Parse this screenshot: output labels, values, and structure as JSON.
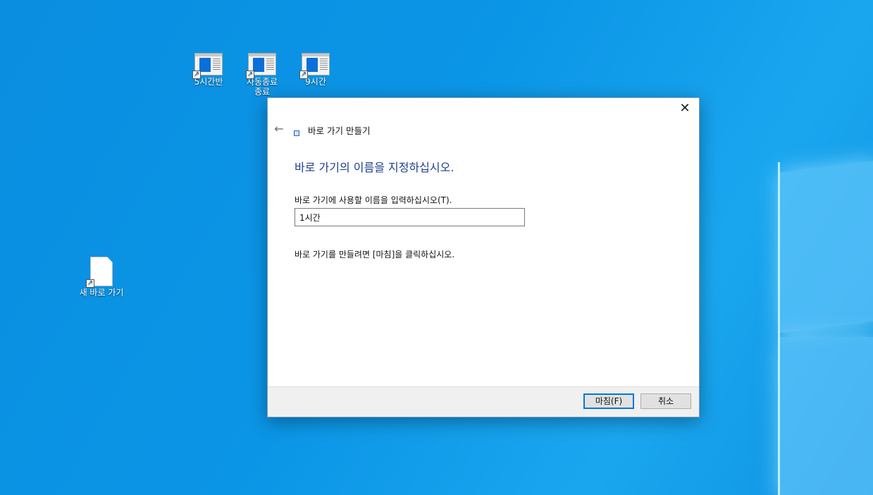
{
  "desktop": {
    "icons": [
      {
        "label": "5시간반"
      },
      {
        "label": "자동종료\n종료"
      },
      {
        "label": "9시간"
      },
      {
        "label": "새 바로 가기"
      }
    ]
  },
  "dialog": {
    "close_glyph": "✕",
    "back_glyph": "←",
    "wizard_title": "바로 가기 만들기",
    "heading": "바로 가기의 이름을 지정하십시오.",
    "field_label": "바로 가기에 사용할 이름을 입력하십시오(T).",
    "name_value": "1시간",
    "hint": "바로 가기를 만들려면 [마침]을 클릭하십시오.",
    "finish_label": "마침(F)",
    "cancel_label": "취소"
  }
}
